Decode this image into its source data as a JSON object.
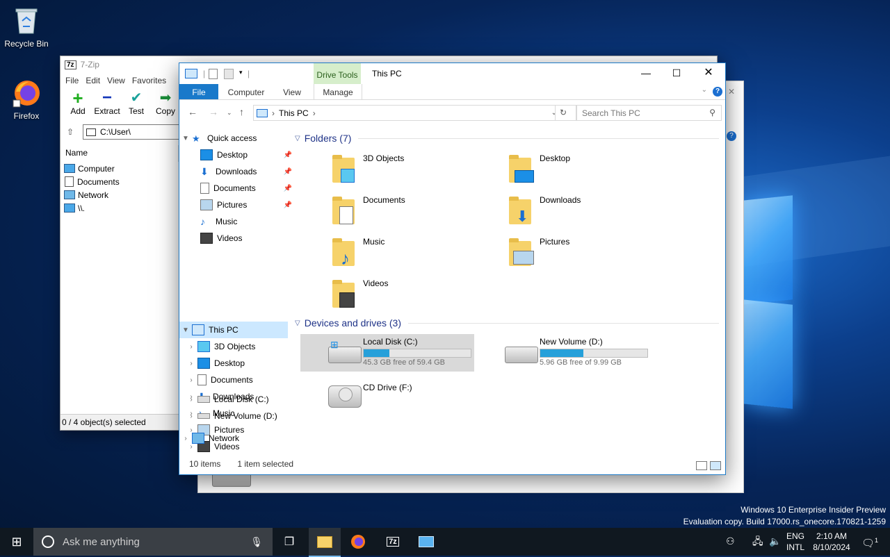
{
  "desktop": {
    "icons": [
      {
        "label": "Recycle Bin",
        "icon": "recycle-bin-icon"
      },
      {
        "label": "Firefox",
        "icon": "firefox-icon"
      }
    ],
    "watermark": {
      "line1": "Windows 10 Enterprise Insider Preview",
      "line2": "Evaluation copy. Build 17000.rs_onecore.170821-1259"
    }
  },
  "sevenzip": {
    "title": "7-Zip",
    "logo": "7z",
    "menu": [
      "File",
      "Edit",
      "View",
      "Favorites"
    ],
    "toolbar": [
      "Add",
      "Extract",
      "Test",
      "Copy"
    ],
    "path": "C:\\User\\",
    "column_name": "Name",
    "items": [
      "Computer",
      "Documents",
      "Network",
      "\\\\."
    ],
    "status": "0 / 4 object(s) selected"
  },
  "explorer": {
    "title": "This PC",
    "context_tab": "Drive Tools",
    "ribbon_tabs": [
      "File",
      "Computer",
      "View",
      "Manage"
    ],
    "breadcrumb": "This PC",
    "search_placeholder": "Search This PC",
    "nav": {
      "quick_access": "Quick access",
      "quick_items": [
        "Desktop",
        "Downloads",
        "Documents",
        "Pictures",
        "Music",
        "Videos"
      ],
      "this_pc": "This PC",
      "pc_items": [
        "3D Objects",
        "Desktop",
        "Documents",
        "Downloads",
        "Music",
        "Pictures",
        "Videos",
        "Local Disk (C:)",
        "New Volume (D:)"
      ],
      "network": "Network"
    },
    "folders_header": "Folders (7)",
    "folders": [
      "3D Objects",
      "Desktop",
      "Documents",
      "Downloads",
      "Music",
      "Pictures",
      "Videos"
    ],
    "devices_header": "Devices and drives (3)",
    "drives": [
      {
        "name": "Local Disk (C:)",
        "free": "45.3 GB free of 59.4 GB",
        "used_fraction": 0.24
      },
      {
        "name": "New Volume (D:)",
        "free": "5.96 GB free of 9.99 GB",
        "used_fraction": 0.4
      },
      {
        "name": "CD Drive (F:)"
      }
    ],
    "status_items": "10 items",
    "status_selected": "1 item selected"
  },
  "taskbar": {
    "search_placeholder": "Ask me anything",
    "lang1": "ENG",
    "lang2": "INTL",
    "time": "2:10 AM",
    "date": "8/10/2024",
    "notification_count": "1"
  },
  "colors": {
    "accent": "#1979ca",
    "selection": "#cce8ff",
    "drive_fill": "#26a0da"
  }
}
